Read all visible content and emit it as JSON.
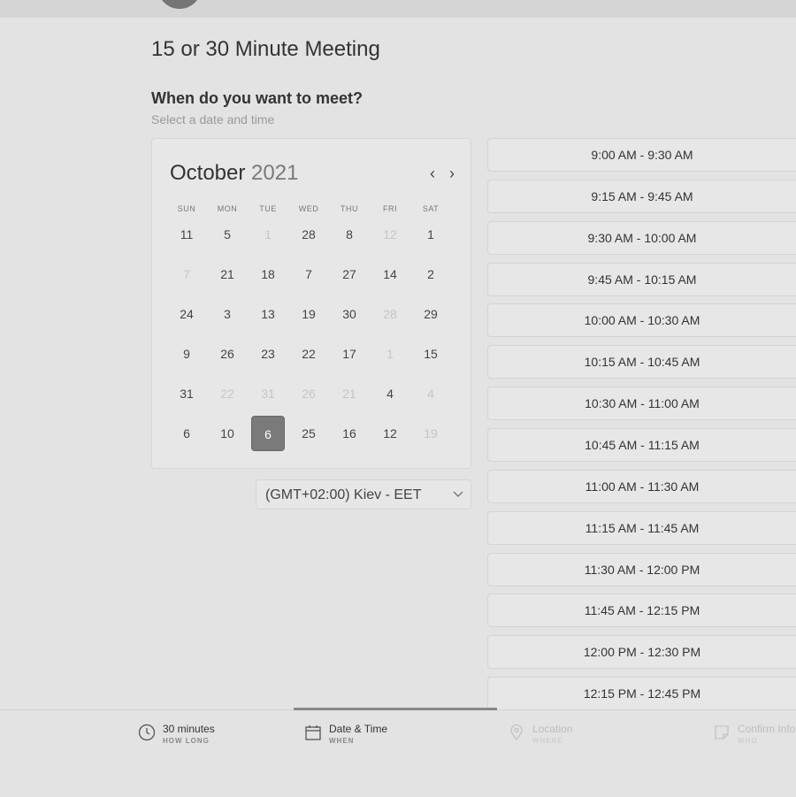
{
  "header": {
    "title": "15 or 30 Minute Meeting"
  },
  "section": {
    "heading": "When do you want to meet?",
    "subtitle": "Select a date and time"
  },
  "calendar": {
    "month": "October",
    "year": "2021",
    "prev_icon": "chevron-left-icon",
    "next_icon": "chevron-right-icon",
    "weekdays": [
      "SUN",
      "MON",
      "TUE",
      "WED",
      "THU",
      "FRI",
      "SAT"
    ],
    "weeks": [
      [
        {
          "d": "11",
          "muted": false
        },
        {
          "d": "5",
          "muted": false
        },
        {
          "d": "1",
          "muted": true
        },
        {
          "d": "28",
          "muted": false
        },
        {
          "d": "8",
          "muted": false
        },
        {
          "d": "12",
          "muted": true
        },
        {
          "d": "1",
          "muted": false
        }
      ],
      [
        {
          "d": "7",
          "muted": true
        },
        {
          "d": "21",
          "muted": false
        },
        {
          "d": "18",
          "muted": false
        },
        {
          "d": "7",
          "muted": false
        },
        {
          "d": "27",
          "muted": false
        },
        {
          "d": "14",
          "muted": false
        },
        {
          "d": "2",
          "muted": false
        }
      ],
      [
        {
          "d": "24",
          "muted": false
        },
        {
          "d": "3",
          "muted": false
        },
        {
          "d": "13",
          "muted": false
        },
        {
          "d": "19",
          "muted": false
        },
        {
          "d": "30",
          "muted": false
        },
        {
          "d": "28",
          "muted": true
        },
        {
          "d": "29",
          "muted": false
        }
      ],
      [
        {
          "d": "9",
          "muted": false
        },
        {
          "d": "26",
          "muted": false
        },
        {
          "d": "23",
          "muted": false
        },
        {
          "d": "22",
          "muted": false
        },
        {
          "d": "17",
          "muted": false
        },
        {
          "d": "1",
          "muted": true
        },
        {
          "d": "15",
          "muted": false
        }
      ],
      [
        {
          "d": "31",
          "muted": false
        },
        {
          "d": "22",
          "muted": true
        },
        {
          "d": "31",
          "muted": true
        },
        {
          "d": "26",
          "muted": true
        },
        {
          "d": "21",
          "muted": true
        },
        {
          "d": "4",
          "muted": false
        },
        {
          "d": "4",
          "muted": true
        }
      ],
      [
        {
          "d": "6",
          "muted": false
        },
        {
          "d": "10",
          "muted": false
        },
        {
          "d": "6",
          "muted": false,
          "selected": true
        },
        {
          "d": "25",
          "muted": false
        },
        {
          "d": "16",
          "muted": false
        },
        {
          "d": "12",
          "muted": false
        },
        {
          "d": "19",
          "muted": true
        }
      ]
    ],
    "selected_color": "#7a7a7a"
  },
  "timezone": {
    "value": "(GMT+02:00) Kiev - EET",
    "icon": "chevron-down-icon"
  },
  "time_slots": [
    "9:00 AM - 9:30 AM",
    "9:15 AM - 9:45 AM",
    "9:30 AM - 10:00 AM",
    "9:45 AM - 10:15 AM",
    "10:00 AM - 10:30 AM",
    "10:15 AM - 10:45 AM",
    "10:30 AM - 11:00 AM",
    "10:45 AM - 11:15 AM",
    "11:00 AM - 11:30 AM",
    "11:15 AM - 11:45 AM",
    "11:30 AM - 12:00 PM",
    "11:45 AM - 12:15 PM",
    "12:00 PM - 12:30 PM",
    "12:15 PM - 12:45 PM"
  ],
  "steps": [
    {
      "label": "30 minutes",
      "sub": "HOW LONG",
      "icon": "clock-icon",
      "active": false,
      "done": true
    },
    {
      "label": "Date & Time",
      "sub": "WHEN",
      "icon": "calendar-icon",
      "active": true,
      "done": false
    },
    {
      "label": "Location",
      "sub": "WHERE",
      "icon": "location-pin-icon",
      "active": false,
      "done": false
    },
    {
      "label": "Confirm Info",
      "sub": "WHO",
      "icon": "note-icon",
      "active": false,
      "done": false
    }
  ]
}
